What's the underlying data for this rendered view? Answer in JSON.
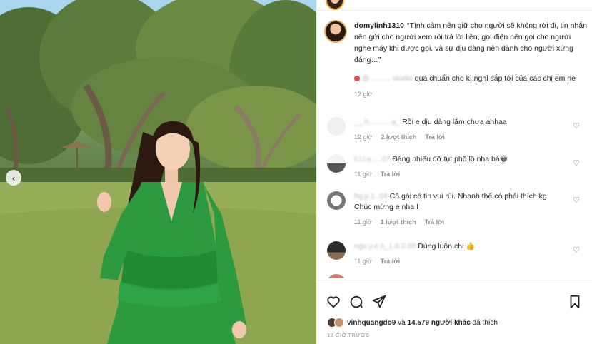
{
  "post": {
    "caption_user": "domylinh1310",
    "caption_text": "“Tình cảm nên giữ cho người sẽ không rời đi, tin nhắn nên gửi cho người xem rồi trả lời liền, gọi điện nên gọi cho người nghe máy khi được gọi, và sự dịu dàng nên dành cho người xứng đáng…”",
    "reply": {
      "user_blurred": "@ ......... studio",
      "text": "quá chuẩn cho kì nghỉ sắp tới của các chị em nè",
      "time": "12 giờ"
    }
  },
  "comments": [
    {
      "user": "__.h...........a_",
      "text": "Rồi e dịu dàng lắm chưa ahhaa",
      "time": "12 giờ",
      "likes": "2 lượt thích",
      "reply": "Trả lời",
      "avatar_color": "#e9e9e9"
    },
    {
      "user": "li.l.l.u.....07",
      "text": "Đáng nhiều đỡ tụt phô lô nha bà😁",
      "time": "11 giờ",
      "likes": "",
      "reply": "Trả lời",
      "avatar_color": "#d6d6d6"
    },
    {
      "user": "hg.p.1..04",
      "text": "Cô gái có tin vui rùi. Nhanh thế có phải thích kg. Chúc mừng e nha !",
      "time": "11 giờ",
      "likes": "1 lượt thích",
      "reply": "Trả lời",
      "avatar_color": "#cfcfcf"
    },
    {
      "user": "ngu.y.e.n_1.0.2.00",
      "text": "Đúng luôn chị 👍",
      "time": "11 giờ",
      "likes": "",
      "reply": "Trả lời",
      "avatar_color": "#3a3a3a"
    }
  ],
  "footer": {
    "liker_user": "vinhquangdo9",
    "likes_joiner": "và",
    "likes_count": "14.579 người khác",
    "likes_suffix": "đã thích",
    "date": "12 GIỜ TRƯỚC"
  },
  "icons": {
    "like": "heart-icon",
    "comment": "comment-icon",
    "share": "share-icon",
    "save": "bookmark-icon",
    "prev": "chevron-left-icon"
  },
  "colors": {
    "dress": "#2c9a3e",
    "link": "#00376b",
    "muted": "#8e8e8e"
  }
}
